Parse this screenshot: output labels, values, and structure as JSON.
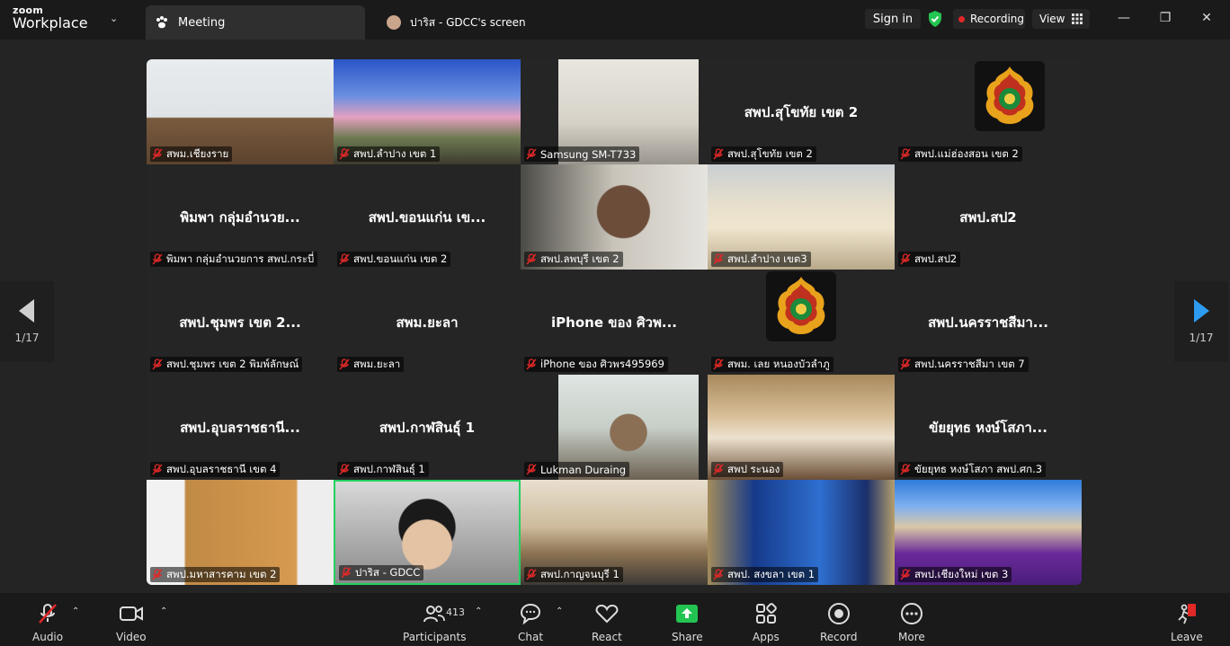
{
  "app": {
    "brand_top": "zoom",
    "brand_bottom": "Workplace"
  },
  "tabs": [
    {
      "label": "Meeting"
    },
    {
      "label": "ปาริส - GDCC's screen"
    }
  ],
  "header": {
    "sign_in": "Sign in",
    "recording": "Recording",
    "view": "View"
  },
  "pager": {
    "left": "1/17",
    "right": "1/17"
  },
  "tiles": [
    {
      "label": "สพม.เชียงราย",
      "center": "",
      "scene": "office"
    },
    {
      "label": "สพป.ลำปาง เขต 1",
      "center": "",
      "scene": "stage"
    },
    {
      "label": "Samsung SM-T733",
      "center": "",
      "scene": "ceiling"
    },
    {
      "label": "สพป.สุโขทัย เขต 2",
      "center": "สพป.สุโขทัย เขต 2",
      "scene": "none"
    },
    {
      "label": "สพป.แม่ฮ่องสอน เขต 2",
      "center": "",
      "scene": "logo"
    },
    {
      "label": "พิมพา กลุ่มอำนวยการ สพป.กระบี่",
      "center": "พิมพา กลุ่มอำนวย...",
      "scene": "none"
    },
    {
      "label": "สพป.ขอนแก่น เขต 2",
      "center": "สพป.ขอนแก่น เข...",
      "scene": "none"
    },
    {
      "label": "สพป.ลพบุรี เขต 2",
      "center": "",
      "scene": "person"
    },
    {
      "label": "สพป.ลำปาง เขต3",
      "center": "",
      "scene": "hall"
    },
    {
      "label": "สพป.สป2",
      "center": "สพป.สป2",
      "scene": "none"
    },
    {
      "label": "สพป.ชุมพร เขต 2 พิมพ์ลักษณ์",
      "center": "สพป.ชุมพร เขต 2...",
      "scene": "none"
    },
    {
      "label": "สพม.ยะลา",
      "center": "สพม.ยะลา",
      "scene": "none"
    },
    {
      "label": "iPhone ของ ศิวพร495969",
      "center": "iPhone ของ ศิวพ...",
      "scene": "none"
    },
    {
      "label": "สพม. เลย หนองบัวลำภู",
      "center": "",
      "scene": "logo"
    },
    {
      "label": "สพป.นครราชสีมา เขต 7",
      "center": "สพป.นครราชสีมา...",
      "scene": "none"
    },
    {
      "label": "สพป.อุบลราชธานี เขต 4",
      "center": "สพป.อุบลราชธานี...",
      "scene": "none"
    },
    {
      "label": "สพป.กาฬสินธุ์ 1",
      "center": "สพป.กาฬสินธุ์ 1",
      "scene": "none"
    },
    {
      "label": "Lukman Duraing",
      "center": "",
      "scene": "officer"
    },
    {
      "label": "สพป ระนอง",
      "center": "",
      "scene": "meeting"
    },
    {
      "label": "ขัยยุทธ หงษ์โสภา สพป.ศก.3",
      "center": "ขัยยุทธ หงษ์โสภา...",
      "scene": "none"
    },
    {
      "label": "สพป.มหาสารคาม เขต 2",
      "center": "",
      "scene": "roomlogo"
    },
    {
      "label": "ปาริส - GDCC",
      "center": "",
      "scene": "face"
    },
    {
      "label": "สพป.กาญจนบุรี 1",
      "center": "",
      "scene": "conf"
    },
    {
      "label": "สพป. สงขลา เขต 1",
      "center": "",
      "scene": "news"
    },
    {
      "label": "สพป.เชียงใหม่ เขต 3",
      "center": "",
      "scene": "purple"
    }
  ],
  "toolbar": {
    "audio": "Audio",
    "video": "Video",
    "participants": "Participants",
    "participants_count": "413",
    "chat": "Chat",
    "react": "React",
    "share": "Share",
    "apps": "Apps",
    "record": "Record",
    "more": "More",
    "leave": "Leave"
  },
  "colors": {
    "active_speaker": "#23d160",
    "share_green": "#23c552",
    "recording_dot": "#e02828",
    "mute_red": "#e02828",
    "shield_green": "#23c552",
    "nav_arrow_blue": "#2d9cf0"
  }
}
